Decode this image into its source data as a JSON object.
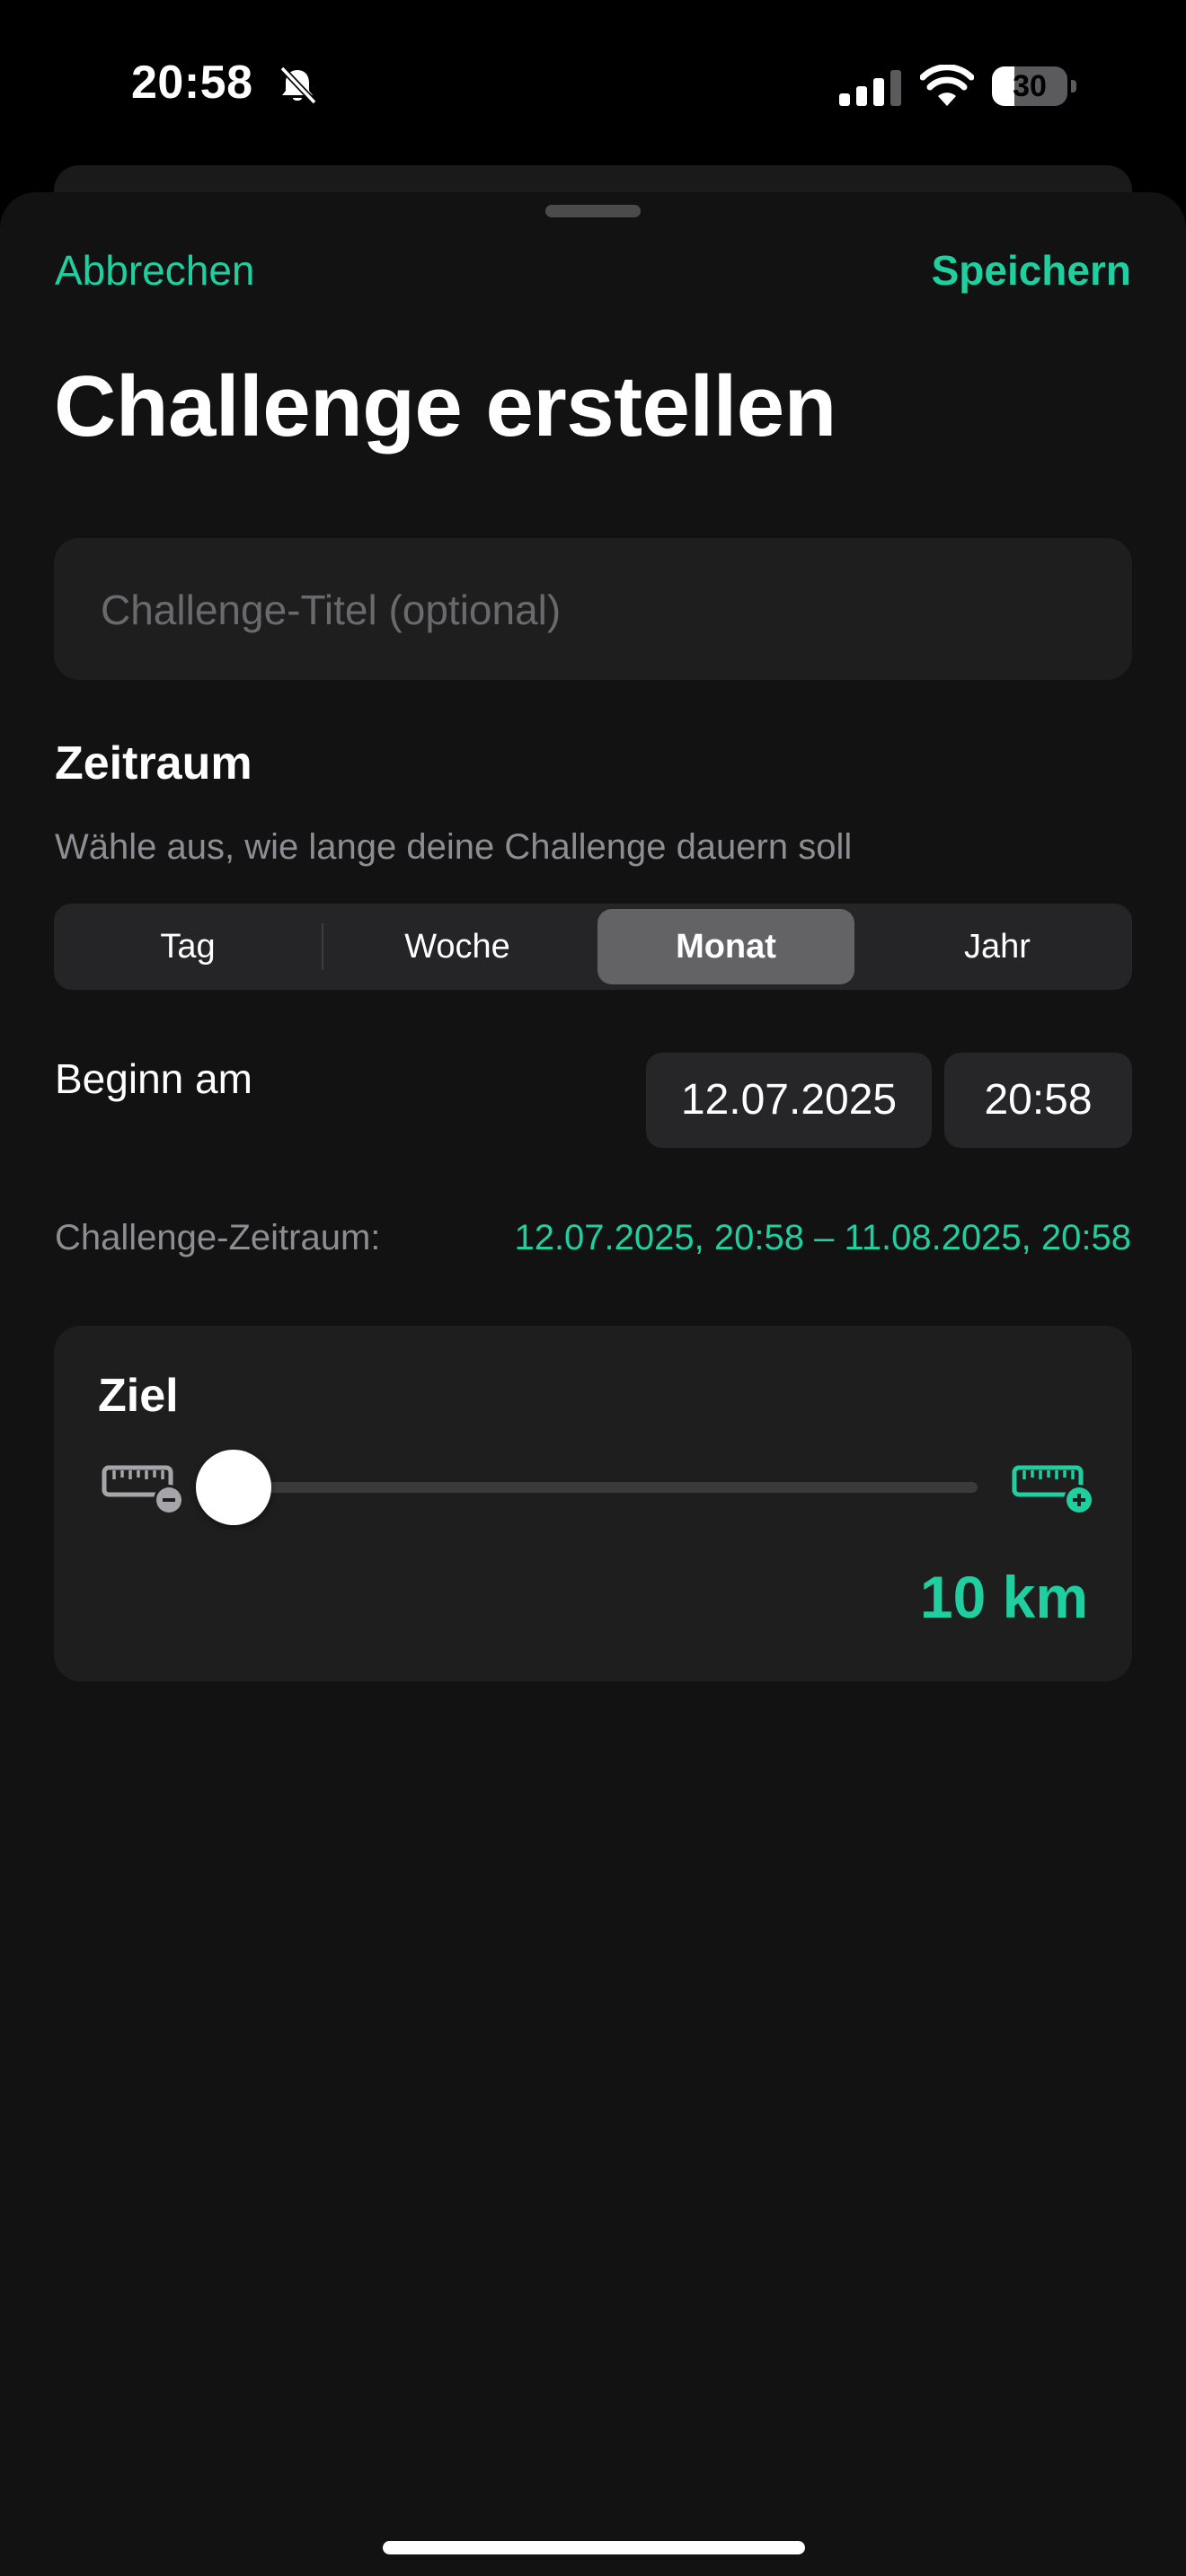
{
  "status_bar": {
    "time": "20:58",
    "silent_icon": "bell-slash-icon",
    "signal_icon": "cellular-signal-icon",
    "wifi_icon": "wifi-icon",
    "battery_percent": 30,
    "battery_label": "30"
  },
  "nav": {
    "cancel_label": "Abbrechen",
    "save_label": "Speichern"
  },
  "page": {
    "title": "Challenge erstellen"
  },
  "title_field": {
    "value": "",
    "placeholder": "Challenge-Titel (optional)"
  },
  "period": {
    "heading": "Zeitraum",
    "description": "Wähle aus, wie lange deine Challenge dauern soll",
    "options": [
      "Tag",
      "Woche",
      "Monat",
      "Jahr"
    ],
    "selected": "Monat"
  },
  "start": {
    "label": "Beginn am",
    "date": "12.07.2025",
    "time": "20:58"
  },
  "summary": {
    "label": "Challenge-Zeitraum:",
    "value": "12.07.2025, 20:58 – 11.08.2025, 20:58"
  },
  "goal": {
    "heading": "Ziel",
    "value_label": "10 km",
    "slider_fraction": 0,
    "decrease_icon": "ruler-minus-icon",
    "increase_icon": "ruler-plus-icon"
  },
  "colors": {
    "accent": "#1fcf9f",
    "background": "#121212",
    "card": "#1e1e1f",
    "secondary_text": "#8d8d92"
  }
}
